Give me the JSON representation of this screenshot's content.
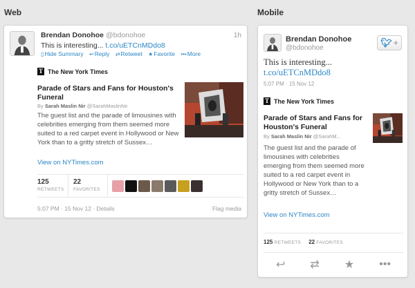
{
  "sections": {
    "web": "Web",
    "mobile": "Mobile"
  },
  "tweet": {
    "name": "Brendan Donohoe",
    "handle": "@bdonohoe",
    "relative_time": "1h",
    "text": "This is interesting...",
    "link": "t.co/uETCnMDdo8",
    "timestamp": "5:07 PM · 15 Nov 12",
    "details": "Details",
    "flag": "Flag media"
  },
  "actions": {
    "hide_summary": "Hide Summary",
    "reply": "Reply",
    "retweet": "Retweet",
    "favorite": "Favorite",
    "more": "More",
    "icons": [
      "document-icon",
      "reply-icon",
      "retweet-icon",
      "star-icon",
      "ellipsis-icon"
    ]
  },
  "card": {
    "publisher": "The New York Times",
    "headline": "Parade of Stars and Fans for Houston's Funeral",
    "byline_prefix": "By",
    "author": "Sarah Maslin Nir",
    "author_handle": "@SarahMaslinNir",
    "author_handle_short": "@SarahM...",
    "summary": "The guest list and the parade of limousines with celebrities emerging from them seemed more suited to a red carpet event in Hollywood or New York than to a gritty stretch of Sussex…",
    "view_on": "View on NYTimes.com"
  },
  "stats": {
    "retweets_count": "125",
    "retweets_label": "RETWEETS",
    "favorites_count": "22",
    "favorites_label": "FAVORITES"
  },
  "colors": {
    "link": "#2a86c6",
    "background": "#e8e8e8"
  }
}
